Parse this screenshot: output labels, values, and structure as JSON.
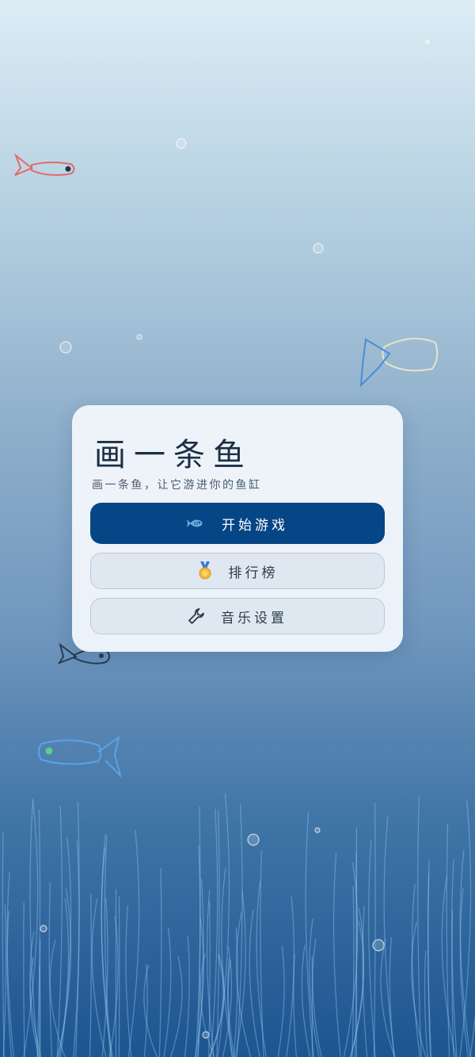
{
  "app": {
    "title": "画一条鱼",
    "subtitle": "画一条鱼，让它游进你的鱼缸"
  },
  "menu": {
    "start": {
      "label": "开始游戏",
      "icon": "fish-icon"
    },
    "leaderboard": {
      "label": "排行榜",
      "icon": "medal-icon"
    },
    "settings": {
      "label": "音乐设置",
      "icon": "wrench-icon"
    }
  },
  "colors": {
    "primary_button": "#064586",
    "card_background": "#f1f6fb",
    "water_top": "#dcedf5",
    "water_bottom": "#1d5590",
    "seaweed": "#8cc4ea"
  },
  "background_fish": [
    {
      "icon": "red-fish-icon",
      "color": "#e06a6a"
    },
    {
      "icon": "outline-blue-fish-icon",
      "color": "#4a8ed0"
    },
    {
      "icon": "dark-fish-icon",
      "color": "#2a3c50"
    },
    {
      "icon": "light-blue-fish-icon",
      "color": "#5aa3e8"
    }
  ]
}
